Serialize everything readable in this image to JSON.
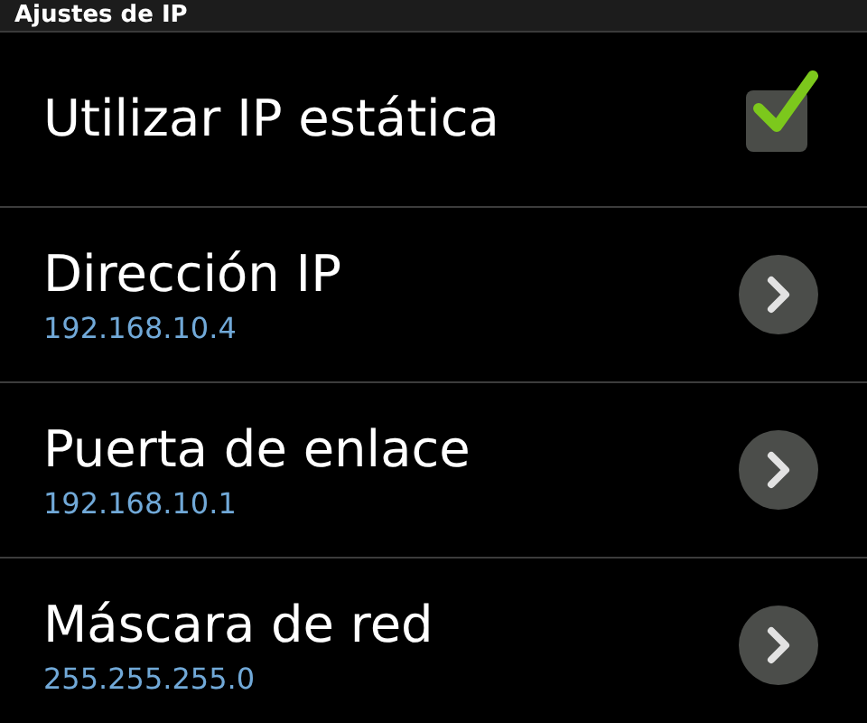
{
  "header": {
    "title": "Ajustes de IP"
  },
  "items": [
    {
      "kind": "checkbox",
      "title": "Utilizar IP estática",
      "checked": true
    },
    {
      "kind": "link",
      "title": "Dirección IP",
      "summary": "192.168.10.4"
    },
    {
      "kind": "link",
      "title": "Puerta de enlace",
      "summary": "192.168.10.1"
    },
    {
      "kind": "link",
      "title": "Máscara de red",
      "summary": "255.255.255.0"
    }
  ]
}
